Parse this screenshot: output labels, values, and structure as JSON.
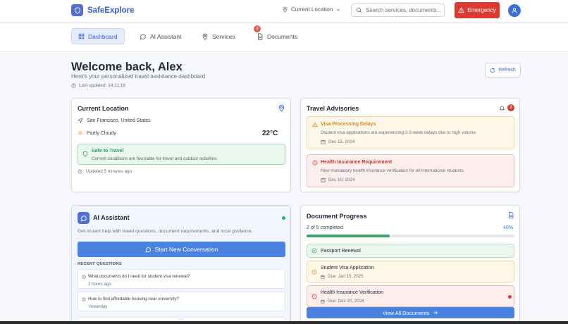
{
  "app": {
    "name": "SafeExplore"
  },
  "header": {
    "location_label": "Current Location",
    "search_placeholder": "Search services, documents...",
    "emergency_label": "Emergency"
  },
  "nav": {
    "tabs": [
      {
        "label": "Dashboard",
        "icon": "grid-icon",
        "active": true
      },
      {
        "label": "AI Assistant",
        "icon": "chat-icon",
        "active": false
      },
      {
        "label": "Services",
        "icon": "pin-icon",
        "active": false
      },
      {
        "label": "Documents",
        "icon": "document-icon",
        "active": false,
        "badge": "3"
      }
    ]
  },
  "welcome": {
    "title": "Welcome back, Alex",
    "subtitle": "Here's your personalized travel assistance dashboard",
    "last_updated": "Last updated: 14:11:16",
    "refresh_label": "Refresh"
  },
  "location_card": {
    "title": "Current Location",
    "place": "San Francisco, United States",
    "weather": "Partly Cloudy",
    "temperature": "22°C",
    "safety_title": "Safe to Travel",
    "safety_desc": "Current conditions are favorable for travel and outdoor activities.",
    "updated": "Updated 5 minutes ago"
  },
  "advisories": {
    "title": "Travel Advisories",
    "count": "2",
    "items": [
      {
        "title": "Visa Processing Delays",
        "desc": "Student visa applications are experiencing 2-3 week delays due to high volume.",
        "date": "Dec 15, 2024",
        "level": "warning"
      },
      {
        "title": "Health Insurance Requirement",
        "desc": "New mandatory health insurance verification for all international students.",
        "date": "Dec 10, 2024",
        "level": "alert"
      }
    ]
  },
  "assistant": {
    "title": "AI Assistant",
    "desc": "Get instant help with travel questions, document requirements, and local guidance.",
    "button_label": "Start New Conversation",
    "recent_label": "RECENT QUESTIONS",
    "questions": [
      {
        "text": "What documents do I need for student visa renewal?",
        "time": "2 hours ago"
      },
      {
        "text": "How to find affordable housing near university?",
        "time": "Yesterday"
      }
    ]
  },
  "documents": {
    "title": "Document Progress",
    "summary": "2 of 5 completed",
    "percent_label": "40%",
    "progress": 0.4,
    "items": [
      {
        "title": "Passport Renewal",
        "status": "completed"
      },
      {
        "title": "Student Visa Application",
        "due": "Due: Jan 15, 2025",
        "status": "pending"
      },
      {
        "title": "Health Insurance Verification",
        "due": "Due: Dec 20, 2024",
        "status": "urgent"
      }
    ],
    "view_all_label": "View All Documents"
  },
  "colors": {
    "brand": "#3b5bd1",
    "emergency": "#dc3a2f",
    "primary_button": "#4a82e0",
    "success": "#3ea56a",
    "warning": "#e29a2b"
  }
}
